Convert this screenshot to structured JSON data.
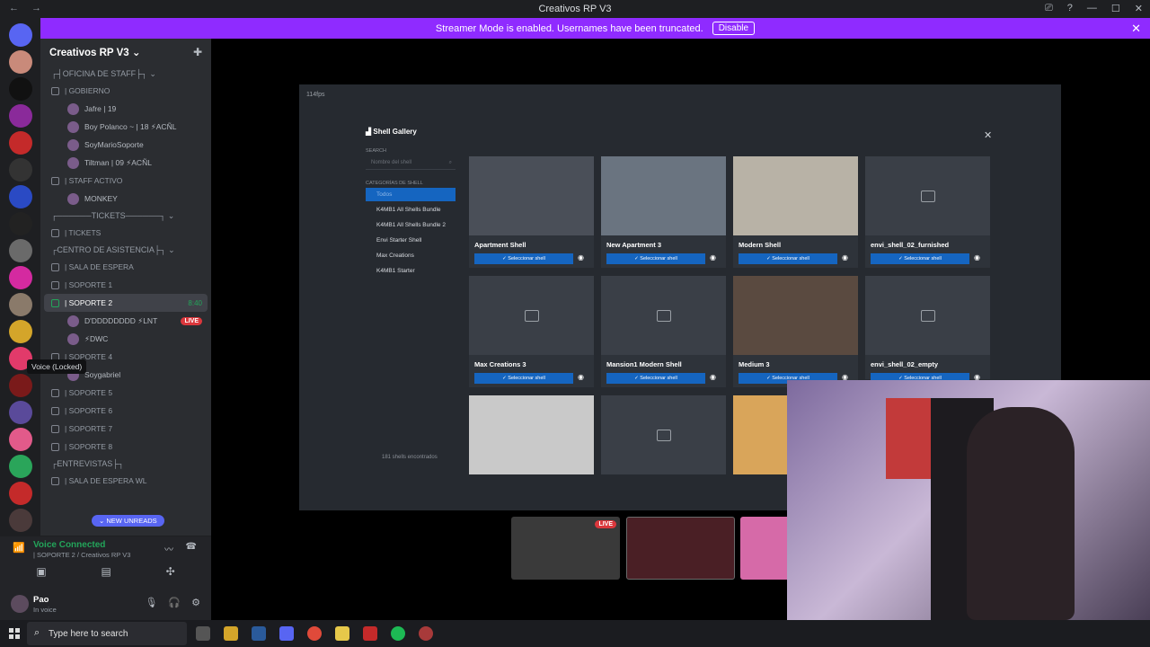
{
  "window": {
    "title": "Creativos RP V3",
    "back": "←",
    "forward": "→",
    "controls": [
      "⎚",
      "?",
      "—",
      "☐",
      "✕"
    ]
  },
  "banner": {
    "text": "Streamer Mode is enabled. Usernames have been truncated.",
    "action": "Disable",
    "close": "✕"
  },
  "server": {
    "name": "Creativos RP V3 ⌄"
  },
  "channels": {
    "items": [
      {
        "kind": "cat",
        "label": "┌┤OFICINA DE STAFF├┐ ⌄"
      },
      {
        "kind": "ch",
        "label": "| GOBIERNO"
      },
      {
        "kind": "user",
        "label": "Jafre | 19"
      },
      {
        "kind": "user",
        "label": "Boy Polanco ~ | 18 ⚡ACÑL"
      },
      {
        "kind": "user",
        "label": "SoyMarioSoporte"
      },
      {
        "kind": "user",
        "label": "Tiltman | 09 ⚡ACÑL"
      },
      {
        "kind": "ch",
        "label": "| STAFF ACTIVO"
      },
      {
        "kind": "user",
        "label": "MONKEY"
      },
      {
        "kind": "cat",
        "label": "┌──────TICKETS──────┐ ⌄"
      },
      {
        "kind": "ch",
        "label": "| TICKETS"
      },
      {
        "kind": "cat",
        "label": "┌CENTRO DE ASISTENCIA├┐ ⌄"
      },
      {
        "kind": "ch",
        "label": "| SALA DE ESPERA"
      },
      {
        "kind": "ch",
        "label": "| SOPORTE 1"
      },
      {
        "kind": "active",
        "label": "| SOPORTE 2",
        "time": "8:40"
      },
      {
        "kind": "live",
        "label": "D'DDDDDDDD ⚡LNT",
        "badge": "LIVE"
      },
      {
        "kind": "user",
        "label": "⚡DWC"
      },
      {
        "kind": "ch",
        "label": "| SOPORTE 4"
      },
      {
        "kind": "user",
        "label": "Soygabriel"
      },
      {
        "kind": "ch",
        "label": "| SOPORTE 5"
      },
      {
        "kind": "ch",
        "label": "| SOPORTE 6"
      },
      {
        "kind": "ch",
        "label": "| SOPORTE 7"
      },
      {
        "kind": "ch",
        "label": "| SOPORTE 8"
      },
      {
        "kind": "cat",
        "label": "┌ENTREVISTAS├┐"
      },
      {
        "kind": "ch",
        "label": "| SALA DE ESPERA WL"
      }
    ]
  },
  "tooltip": "Voice (Locked)",
  "new_unreads": "⌄ NEW UNREADS",
  "voice": {
    "status": "Voice Connected",
    "sub": "| SOPORTE 2 / Creativos RP V3"
  },
  "user": {
    "name": "Pao",
    "status": "In voice"
  },
  "game": {
    "fps": "114fps",
    "gallery_title": "Shell Gallery",
    "search_label": "SEARCH",
    "search_placeholder": "Nombre del shell",
    "categories_label": "CATEGORÍAS DE SHELL",
    "categories": [
      "Todos",
      "K4MB1 All Shells Bundle",
      "K4MB1 All Shells Bundle 2",
      "Envi Starter Shell",
      "Max Creations",
      "K4MB1 Starter"
    ],
    "found": "181 shells encontrados",
    "select_label": "✓ Seleccionar shell",
    "close": "✕",
    "cards": [
      {
        "name": "Apartment Shell",
        "img": "#4a4f58"
      },
      {
        "name": "New Apartment 3",
        "img": "#6a7480"
      },
      {
        "name": "Modern Shell",
        "img": "#b8b2a6"
      },
      {
        "name": "envi_shell_02_furnished",
        "img": ""
      },
      {
        "name": "Max Creations 3",
        "img": ""
      },
      {
        "name": "Mansion1 Modern Shell",
        "img": ""
      },
      {
        "name": "Medium 3",
        "img": "#5a4a40"
      },
      {
        "name": "envi_shell_02_empty",
        "img": ""
      },
      {
        "name": "",
        "img": "#c9c9c9"
      },
      {
        "name": "",
        "img": ""
      },
      {
        "name": "",
        "img": "#d9a55a"
      }
    ]
  },
  "tiles": {
    "live": "LIVE"
  },
  "taskbar": {
    "search": "Type here to search"
  },
  "colors": {
    "accent": "#8f2bff",
    "button": "#1565c0",
    "green": "#23a55a",
    "live": "#da373c"
  }
}
